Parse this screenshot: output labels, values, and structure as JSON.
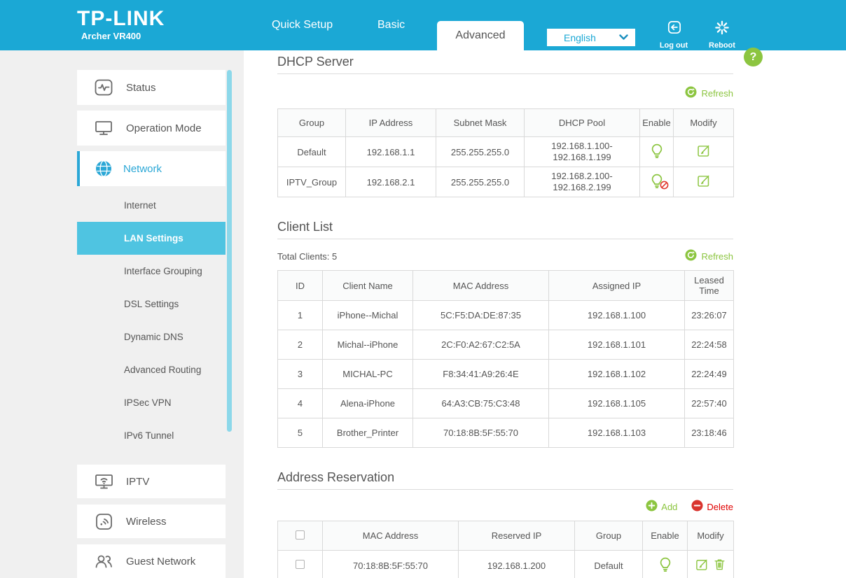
{
  "header": {
    "brand": "TP-LINK",
    "model": "Archer VR400",
    "nav": [
      {
        "label": "Quick Setup",
        "active": false
      },
      {
        "label": "Basic",
        "active": false
      },
      {
        "label": "Advanced",
        "active": true
      }
    ],
    "language": {
      "value": "English"
    },
    "logout_label": "Log out",
    "reboot_label": "Reboot",
    "help_label": "?"
  },
  "colors": {
    "header_blue": "#1ba8d5",
    "submenu_highlight": "#4fc4e1",
    "accent_green": "#8cc540",
    "danger_red": "#e00000",
    "sidebar_gray": "#f0f0f0"
  },
  "sidebar": {
    "items": [
      {
        "label": "Status",
        "active": false
      },
      {
        "label": "Operation Mode",
        "active": false
      },
      {
        "label": "Network",
        "active": true
      },
      {
        "label": "IPTV",
        "active": false
      },
      {
        "label": "Wireless",
        "active": false
      },
      {
        "label": "Guest Network",
        "active": false
      }
    ],
    "network_submenu": [
      {
        "label": "Internet",
        "active": false
      },
      {
        "label": "LAN Settings",
        "active": true
      },
      {
        "label": "Interface Grouping",
        "active": false
      },
      {
        "label": "DSL Settings",
        "active": false
      },
      {
        "label": "Dynamic DNS",
        "active": false
      },
      {
        "label": "Advanced Routing",
        "active": false
      },
      {
        "label": "IPSec VPN",
        "active": false
      },
      {
        "label": "IPv6 Tunnel",
        "active": false
      }
    ]
  },
  "dhcp": {
    "title": "DHCP Server",
    "refresh_label": "Refresh",
    "columns": [
      "Group",
      "IP Address",
      "Subnet Mask",
      "DHCP Pool",
      "Enable",
      "Modify"
    ],
    "rows": [
      {
        "group": "Default",
        "ip": "192.168.1.1",
        "mask": "255.255.255.0",
        "pool": [
          "192.168.1.100-",
          "192.168.1.199"
        ],
        "enabled": true
      },
      {
        "group": "IPTV_Group",
        "ip": "192.168.2.1",
        "mask": "255.255.255.0",
        "pool": [
          "192.168.2.100-",
          "192.168.2.199"
        ],
        "enabled": false
      }
    ]
  },
  "clients": {
    "title": "Client List",
    "total_label": "Total Clients: 5",
    "refresh_label": "Refresh",
    "columns": [
      "ID",
      "Client Name",
      "MAC Address",
      "Assigned IP",
      "Leased Time"
    ],
    "rows": [
      {
        "id": "1",
        "name": "iPhone--Michal",
        "mac": "5C:F5:DA:DE:87:35",
        "ip": "192.168.1.100",
        "lease": "23:26:07"
      },
      {
        "id": "2",
        "name": "Michal--iPhone",
        "mac": "2C:F0:A2:67:C2:5A",
        "ip": "192.168.1.101",
        "lease": "22:24:58"
      },
      {
        "id": "3",
        "name": "MICHAL-PC",
        "mac": "F8:34:41:A9:26:4E",
        "ip": "192.168.1.102",
        "lease": "22:24:49"
      },
      {
        "id": "4",
        "name": "Alena-iPhone",
        "mac": "64:A3:CB:75:C3:48",
        "ip": "192.168.1.105",
        "lease": "22:57:40"
      },
      {
        "id": "5",
        "name": "Brother_Printer",
        "mac": "70:18:8B:5F:55:70",
        "ip": "192.168.1.103",
        "lease": "23:18:46"
      }
    ]
  },
  "reservation": {
    "title": "Address Reservation",
    "add_label": "Add",
    "delete_label": "Delete",
    "columns": [
      "MAC Address",
      "Reserved IP",
      "Group",
      "Enable",
      "Modify"
    ],
    "rows": [
      {
        "mac": "70:18:8B:5F:55:70",
        "reserved_ip": "192.168.1.200",
        "group": "Default",
        "enabled": true
      }
    ]
  }
}
